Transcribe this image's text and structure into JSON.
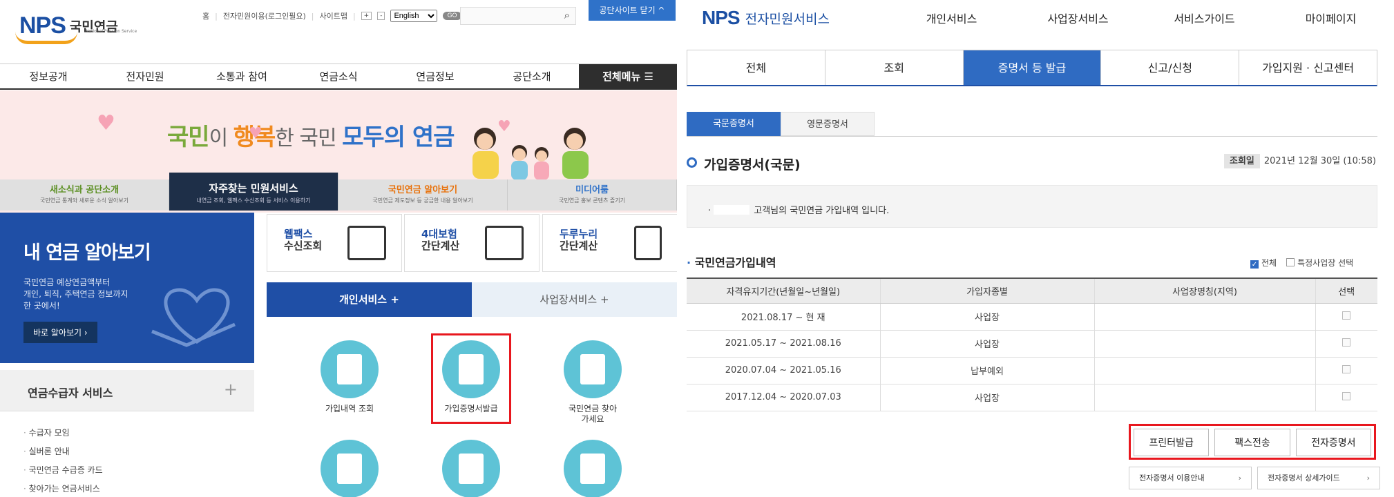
{
  "left": {
    "logo": {
      "mark": "NPS",
      "korean": "국민연금",
      "sub": "National Pension Service"
    },
    "util": {
      "home": "홈",
      "login": "전자민원이용(로그인필요)",
      "sitemap": "사이트맵",
      "zoom_in": "+",
      "zoom_out": "-",
      "language": "English",
      "go": "GO"
    },
    "site_close": "공단사이트 닫기 ^",
    "gnb": [
      "정보공개",
      "전자민원",
      "소통과 참여",
      "연금소식",
      "연금정보",
      "공단소개"
    ],
    "all_menu": "전체메뉴 ☰",
    "banner": {
      "w1": "국민",
      "w2": "이 ",
      "w3": "행복",
      "w4": "한 국민 ",
      "w5": "모두의 연금"
    },
    "tabs": [
      {
        "title": "새소식과 공단소개",
        "sub": "국민연금 통계와 새로운 소식 알아보기"
      },
      {
        "title": "자주찾는 민원서비스",
        "sub": "내연금 조회, 웹팩스 수신조회 등 서비스 이용하기"
      },
      {
        "title": "국민연금 알아보기",
        "sub": "국민연금 제도정보 등 궁금한 내용 알아보기"
      },
      {
        "title": "미디어룸",
        "sub": "국민연금 홍보 콘텐츠 즐기기"
      }
    ],
    "pension": {
      "title": "내 연금 알아보기",
      "desc1": "국민연금 예상연금액부터",
      "desc2": "개인, 퇴직, 주택연금 정보까지",
      "desc3": "한 곳에서!",
      "button": "바로 알아보기 ›"
    },
    "quick": [
      {
        "l1": "웹팩스",
        "l2": "수신조회"
      },
      {
        "l1": "4대보험",
        "l2": "간단계산"
      },
      {
        "l1": "두루누리",
        "l2": "간단계산"
      }
    ],
    "svc_tabs": {
      "personal": "개인서비스 +",
      "business": "사업장서비스 +"
    },
    "services": [
      {
        "label": "가입내역 조회"
      },
      {
        "label": "가입증명서발급"
      },
      {
        "label": "국민연금 찾아가세요"
      }
    ],
    "receiver": {
      "title": "연금수급자 서비스",
      "plus": "+",
      "items": [
        "수급자 모임",
        "실버론 안내",
        "국민연금 수급증 카드",
        "찾아가는 연금서비스"
      ]
    }
  },
  "right": {
    "logo": {
      "mark": "NPS",
      "korean": "전자민원서비스"
    },
    "gnb": [
      "개인서비스",
      "사업장서비스",
      "서비스가이드",
      "마이페이지"
    ],
    "tabs": [
      "전체",
      "조회",
      "증명서 등 발급",
      "신고/신청",
      "가입지원 · 신고센터"
    ],
    "sub_tabs": [
      "국문증명서",
      "영문증명서"
    ],
    "title": "가입증명서(국문)",
    "inquiry_label": "조회일",
    "inquiry_date": "2021년 12월 30일 (10:58)",
    "notice": "고객님의 국민연금 가입내역 입니다.",
    "hist_title": "국민연금가입내역",
    "check_all": "전체",
    "check_specific": "특정사업장 선택",
    "table": {
      "headers": [
        "자격유지기간(년월일~년월일)",
        "가입자종별",
        "사업장명칭(지역)",
        "선택"
      ],
      "rows": [
        {
          "period": "2021.08.17 ~ 현 재",
          "type": "사업장",
          "name": ""
        },
        {
          "period": "2021.05.17 ~ 2021.08.16",
          "type": "사업장",
          "name": ""
        },
        {
          "period": "2020.07.04 ~ 2021.05.16",
          "type": "납부예외",
          "name": ""
        },
        {
          "period": "2017.12.04 ~ 2020.07.03",
          "type": "사업장",
          "name": ""
        }
      ]
    },
    "actions": {
      "print": "프린터발급",
      "fax": "팩스전송",
      "electronic": "전자증명서"
    },
    "guides": {
      "usage": "전자증명서 이용안내",
      "detail": "전자증명서 상세가이드"
    }
  }
}
